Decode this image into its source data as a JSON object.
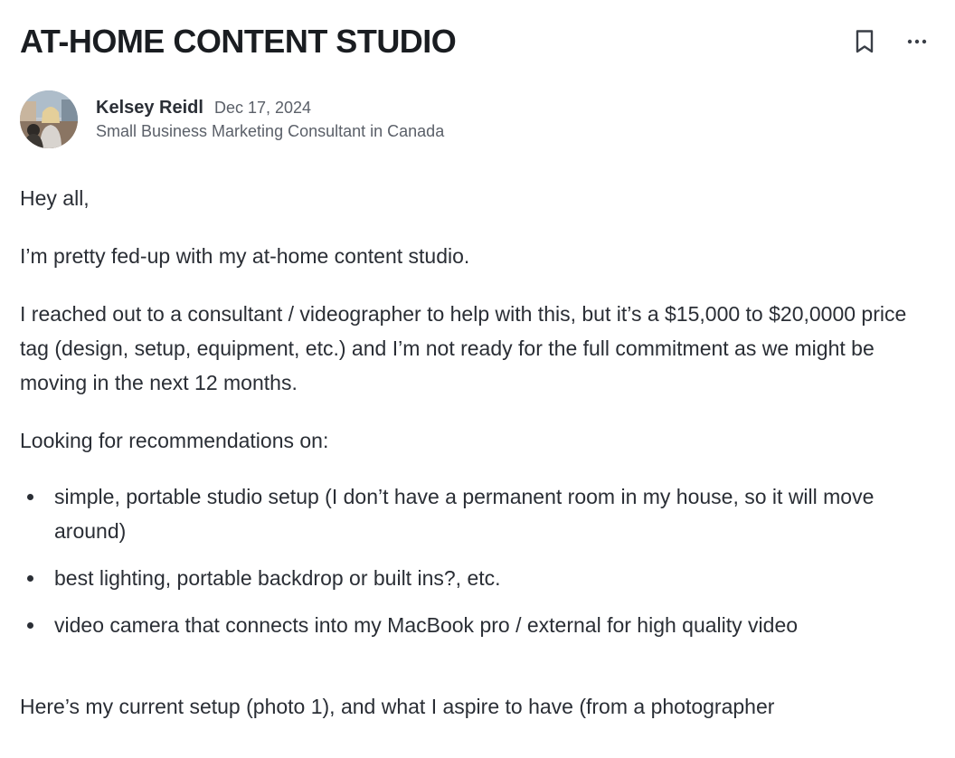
{
  "post": {
    "title": "AT-HOME CONTENT STUDIO",
    "actions": {
      "bookmark_icon": "bookmark-icon",
      "more_icon": "more-options-icon"
    },
    "author": {
      "name": "Kelsey Reidl",
      "date": "Dec 17, 2024",
      "role": "Small Business Marketing Consultant in Canada",
      "avatar_icon": "avatar"
    },
    "body": {
      "greeting": "Hey all,",
      "paragraph_1": "I’m pretty fed-up with my at-home content studio.",
      "paragraph_2": "I reached out to a consultant / videographer to help with this, but it’s a $15,000 to $20,0000 price tag (design, setup, equipment, etc.) and I’m not ready for the full commitment as we might be moving in the next 12 months.",
      "paragraph_3": "Looking for recommendations on:",
      "list_items": [
        "simple, portable studio setup (I don’t have a permanent room in my house, so it will move around)",
        "best lighting, portable backdrop or built ins?, etc.",
        "video camera that connects into my MacBook pro / external for high quality video"
      ],
      "paragraph_4": "Here’s my current setup (photo 1), and what I aspire to have (from a photographer"
    }
  }
}
